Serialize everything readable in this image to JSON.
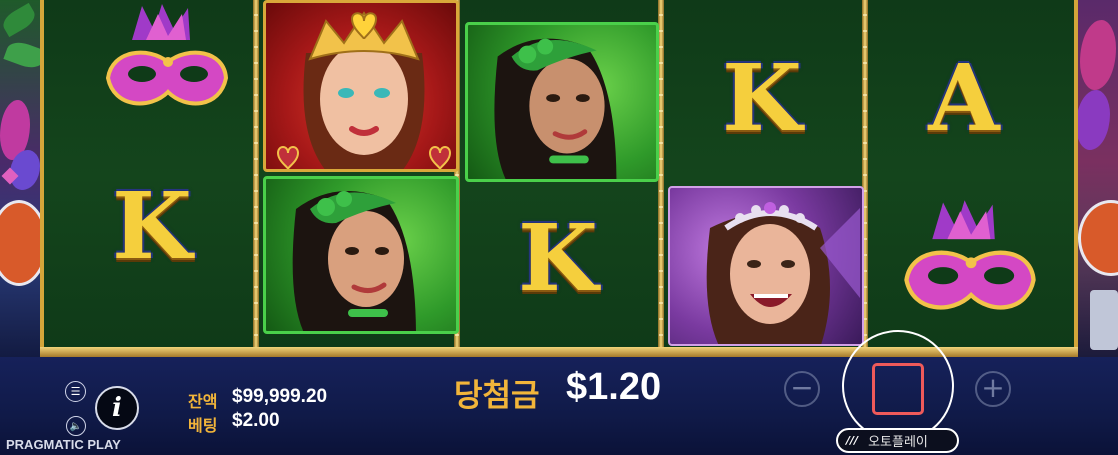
{
  "game": {
    "provider": "PRAGMATIC PLAY",
    "reels": [
      [
        "purple-mask",
        "K"
      ],
      [
        "queen-portrait",
        "green-dancer-portrait"
      ],
      [
        "green-dancer-portrait",
        "K"
      ],
      [
        "K",
        "purple-dancer-portrait"
      ],
      [
        "A",
        "purple-mask"
      ]
    ]
  },
  "symbols": {
    "K": "K",
    "A": "A"
  },
  "status": {
    "balance_label": "잔액",
    "balance_value": "$99,999.20",
    "bet_label": "베팅",
    "bet_value": "$2.00",
    "win_label": "당첨금",
    "win_value": "$1.20"
  },
  "controls": {
    "menu_icon": "menu-icon",
    "info_icon": "info-icon",
    "sound_icon": "sound-icon",
    "info_glyph": "i",
    "minus_glyph": "−",
    "plus_glyph": "+",
    "autoplay_label": "오토플레이",
    "autoplay_icon_glyph": "///",
    "stop_color": "#ef5a5a"
  },
  "colors": {
    "reel_bg": "#14451c",
    "gold": "#f5cf3d",
    "win_label": "#f2b53a",
    "ui_bg": "#101a48"
  }
}
